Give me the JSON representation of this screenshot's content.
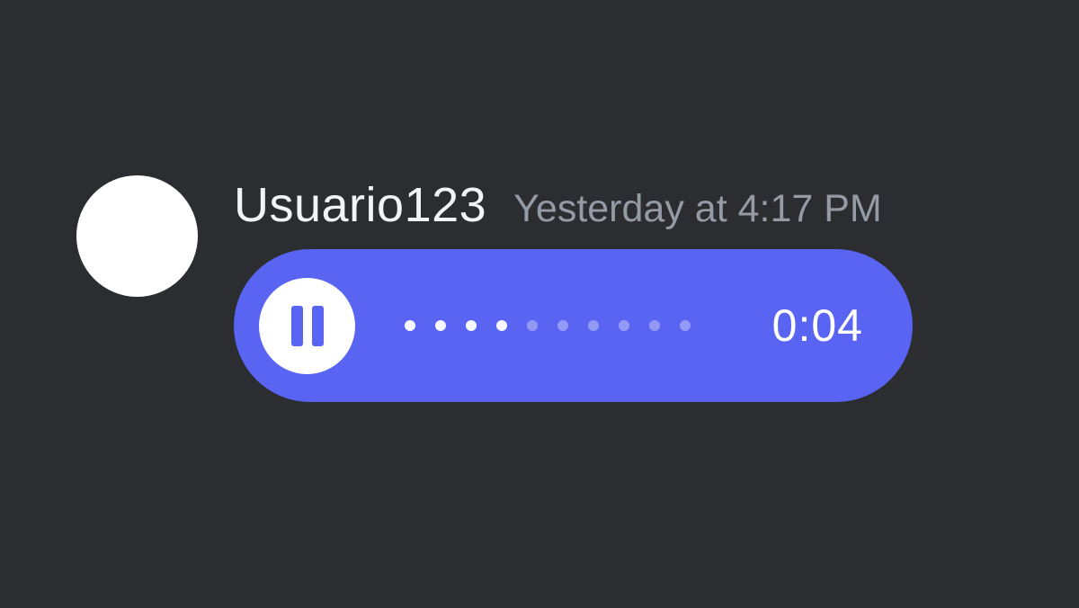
{
  "message": {
    "username": "Usuario123",
    "timestamp": "Yesterday at 4:17 PM",
    "voice": {
      "duration": "0:04",
      "state": "playing",
      "progress_dots_played": 4,
      "progress_dots_total": 10
    }
  },
  "colors": {
    "background": "#2b2d31",
    "accent": "#5965f2",
    "text_primary": "#f2f3f5",
    "text_muted": "#949ba4",
    "avatar": "#ffffff"
  }
}
